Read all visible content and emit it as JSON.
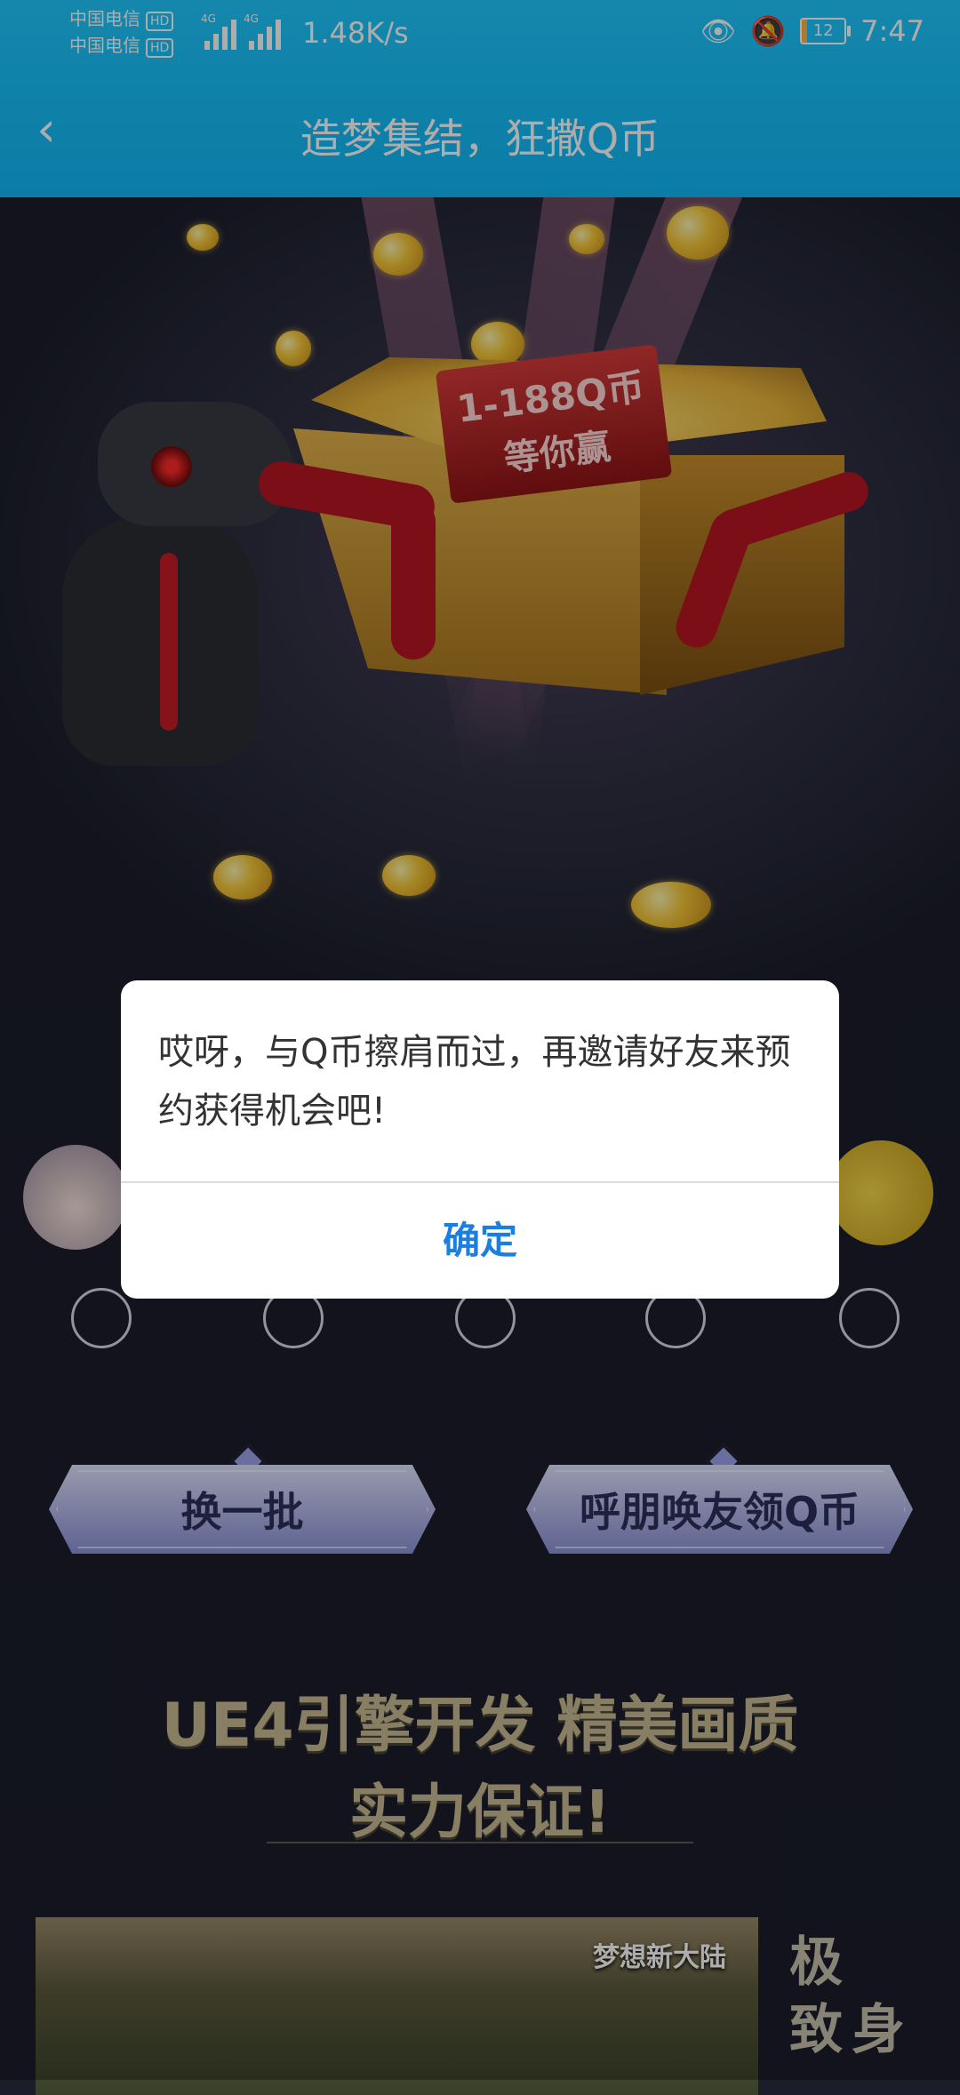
{
  "status_bar": {
    "carrier1": "中国电信",
    "carrier2": "中国电信",
    "hd": "HD",
    "network": "4G",
    "speed": "1.48K/s",
    "battery": "12",
    "time": "7:47"
  },
  "header": {
    "title": "造梦集结，狂撒Q币"
  },
  "hero": {
    "banner_line1": "1-188Q币",
    "banner_line2": "等你赢"
  },
  "actions": {
    "refresh_label": "换一批",
    "invite_label": "呼朋唤友领Q币"
  },
  "slogan": {
    "line1": "UE4引擎开发 精美画质",
    "line2": "实力保证!"
  },
  "promo": {
    "logo": "梦想新大陆",
    "side_chars": [
      "极",
      "致",
      "身"
    ]
  },
  "dialog": {
    "message": "哎呀，与Q币擦肩而过，再邀请好友来预约获得机会吧!",
    "confirm": "确定"
  }
}
